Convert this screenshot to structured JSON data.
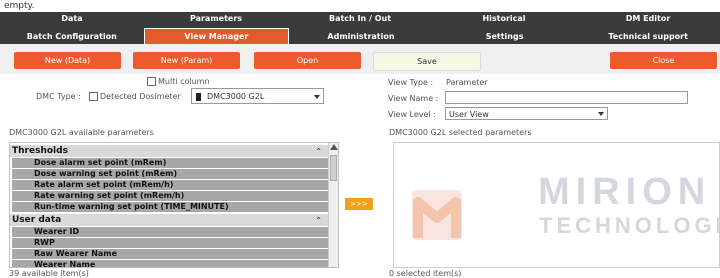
{
  "topstrip": {
    "text": "empty."
  },
  "nav_row1": [
    {
      "label": "Data"
    },
    {
      "label": "Parameters"
    },
    {
      "label": "Batch In / Out"
    },
    {
      "label": "Historical"
    },
    {
      "label": "DM Editor"
    }
  ],
  "nav_row2": [
    {
      "label": "Batch Configuration"
    },
    {
      "label": "View Manager"
    },
    {
      "label": "Administration"
    },
    {
      "label": "Settings"
    },
    {
      "label": "Technical support"
    }
  ],
  "toolbar": {
    "new_data": "New (Data)",
    "new_param": "New (Param)",
    "open": "Open",
    "save": "Save",
    "close": "Close"
  },
  "left_form": {
    "multi_column": "Multi column",
    "dmc_type": "DMC Type :",
    "detected_dosimeter": "Detected Dosimeter",
    "dosimeter_value": "DMC3000 G2L"
  },
  "right_form": {
    "view_type": "View Type :",
    "view_type_value": "Parameter",
    "view_name": "View Name :",
    "view_name_value": "",
    "view_level": "View Level :",
    "view_level_value": "User View"
  },
  "sections": {
    "available": "DMC3000 G2L available parameters",
    "selected": "DMC3000 G2L selected parameters"
  },
  "groups": [
    {
      "name": "Thresholds",
      "items": [
        "Dose alarm set point (mRem)",
        "Dose warning set point (mRem)",
        "Rate alarm set point (mRem/h)",
        "Rate warning set point (mRem/h)",
        "Run-time warning set point (TIME_MINUTE)"
      ]
    },
    {
      "name": "User data",
      "items": [
        "Wearer ID",
        "RWP",
        "Raw Wearer Name",
        "Wearer Name"
      ]
    }
  ],
  "transfer_button": ">>>",
  "brand": {
    "line1": "MIRION",
    "line2": "TECHNOLOGIES"
  },
  "counts": {
    "available": "39 available item(s)",
    "selected": "0 selected item(s)"
  }
}
